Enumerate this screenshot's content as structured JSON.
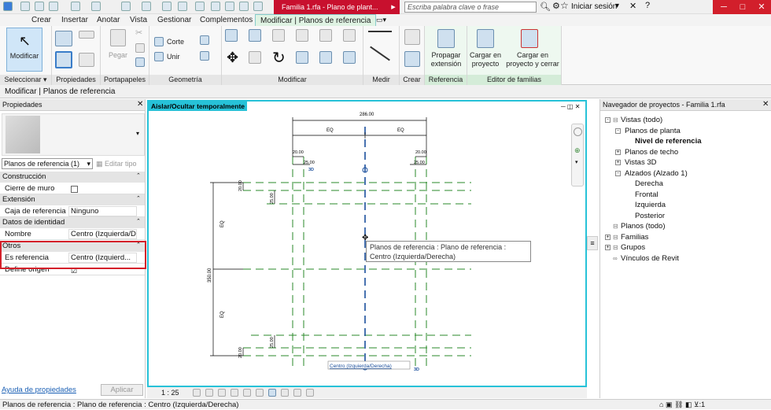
{
  "title_bar": {
    "document_title": "Familia 1.rfa - Plano de plant...",
    "search_placeholder": "Escriba palabra clave o frase",
    "login_label": "Iniciar sesión"
  },
  "ribbon_tabs": [
    "Crear",
    "Insertar",
    "Anotar",
    "Vista",
    "Gestionar",
    "Complementos",
    "Modificar | Planos de referencia"
  ],
  "ribbon_groups": {
    "select": {
      "button": "Modificar",
      "label": "Seleccionar"
    },
    "properties": "Propiedades",
    "clipboard": {
      "label": "Portapapeles",
      "paste": "Pegar"
    },
    "geometry": {
      "label": "Geometría",
      "cut": "Corte",
      "join": "Unir"
    },
    "modify": "Modificar",
    "measure": "Medir",
    "create": "Crear",
    "reference": {
      "label": "Referencia",
      "propagate": "Propagar extensión"
    },
    "family_editor": {
      "label": "Editor de familias",
      "load": "Cargar en proyecto",
      "load_close": "Cargar en proyecto y cerrar"
    }
  },
  "options_bar": "Modificar | Planos de referencia",
  "properties": {
    "header": "Propiedades",
    "type_selector": "Planos de referencia (1)",
    "edit_type": "Editar tipo",
    "sections": [
      {
        "name": "Construcción",
        "rows": [
          {
            "key": "Cierre de muro",
            "value": "",
            "checkbox": true
          }
        ]
      },
      {
        "name": "Extensión",
        "rows": [
          {
            "key": "Caja de referencia",
            "value": "Ninguno"
          }
        ]
      },
      {
        "name": "Datos de identidad",
        "rows": [
          {
            "key": "Nombre",
            "value": "Centro (Izquierda/Derecha)"
          }
        ]
      },
      {
        "name": "Otros",
        "rows": [
          {
            "key": "Es referencia",
            "value": "Centro (Izquierd..."
          },
          {
            "key": "Define origen",
            "value": "",
            "checkbox": true,
            "checked": true
          }
        ]
      }
    ],
    "help_link": "Ayuda de propiedades",
    "apply": "Aplicar"
  },
  "canvas": {
    "isolate_label": "Aislar/Ocultar temporalmente",
    "dims": {
      "top_total": "286.00",
      "eq": "EQ",
      "d20": "20.00",
      "d25": "25.00",
      "left_total": "350.00",
      "label_3d": "3D"
    },
    "tooltip": "Planos de referencia : Plano de referencia : Centro (Izquierda/Derecha)",
    "ref_label": "Centro (Izquierda/Derecha)",
    "scale": "1 : 25"
  },
  "browser": {
    "header": "Navegador de proyectos - Familia 1.rfa",
    "tree": [
      {
        "label": "Vistas (todo)",
        "level": 0,
        "expander": "-"
      },
      {
        "label": "Planos de planta",
        "level": 1,
        "expander": "-"
      },
      {
        "label": "Nivel de referencia",
        "level": 2,
        "bold": true
      },
      {
        "label": "Planos de techo",
        "level": 1,
        "expander": "+"
      },
      {
        "label": "Vistas 3D",
        "level": 1,
        "expander": "+"
      },
      {
        "label": "Alzados (Alzado 1)",
        "level": 1,
        "expander": "-"
      },
      {
        "label": "Derecha",
        "level": 2
      },
      {
        "label": "Frontal",
        "level": 2
      },
      {
        "label": "Izquierda",
        "level": 2
      },
      {
        "label": "Posterior",
        "level": 2
      },
      {
        "label": "Planos (todo)",
        "level": 0
      },
      {
        "label": "Familias",
        "level": 0,
        "expander": "+"
      },
      {
        "label": "Grupos",
        "level": 0,
        "expander": "+"
      },
      {
        "label": "Vínculos de Revit",
        "level": 0
      }
    ]
  },
  "status_bar": "Planos de referencia : Plano de referencia : Centro (Izquierda/Derecha)",
  "colors": {
    "accent": "#27c2d8",
    "brand_red": "#c8102e",
    "highlight": "#d4202a"
  }
}
